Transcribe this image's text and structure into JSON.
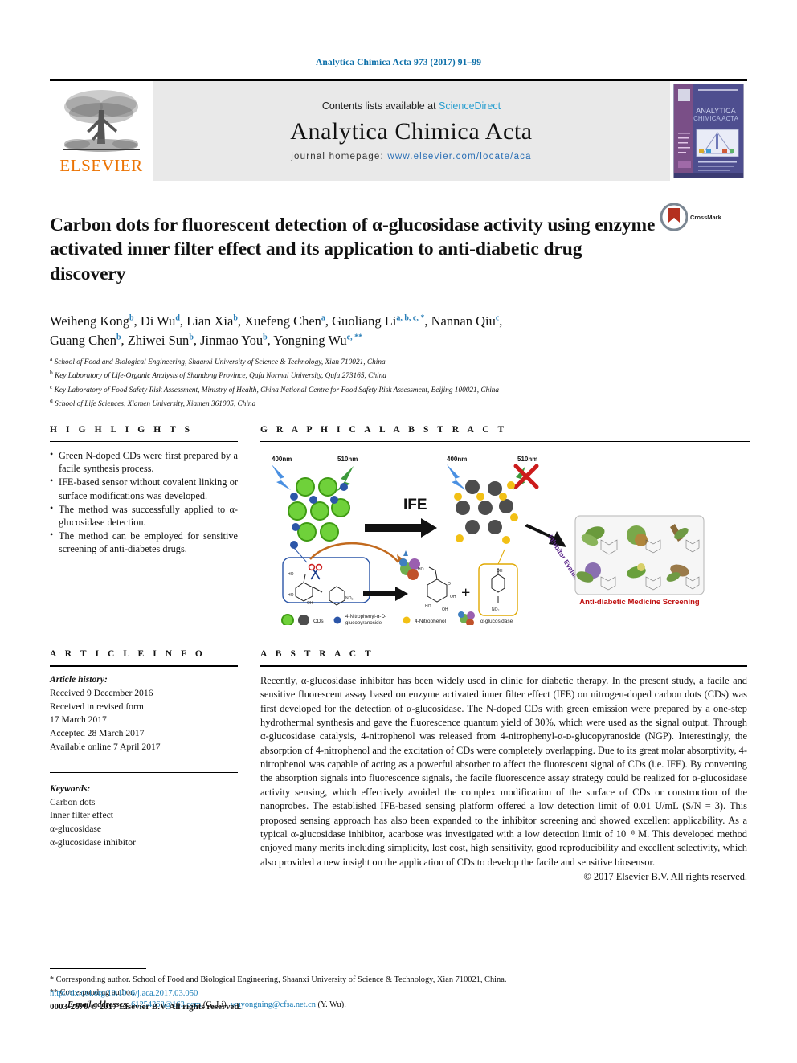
{
  "running_head": "Analytica Chimica Acta 973 (2017) 91–99",
  "masthead": {
    "publisher_logo_text": "ELSEVIER",
    "contents_prefix": "Contents lists available at ",
    "contents_link": "ScienceDirect",
    "journal_name": "Analytica Chimica Acta",
    "homepage_prefix": "journal homepage: ",
    "homepage_url": "www.elsevier.com/locate/aca",
    "cover_title_line1": "ANALYTICA",
    "cover_title_line2": "CHIMICA ACTA"
  },
  "article": {
    "title": "Carbon dots for fluorescent detection of α-glucosidase activity using enzyme activated inner filter effect and its application to anti-diabetic drug discovery",
    "crossmark_label": "CrossMark",
    "authors_line1_parts": [
      {
        "name": "Weiheng Kong",
        "sup": "b",
        "sep": ", "
      },
      {
        "name": "Di Wu",
        "sup": "d",
        "sep": ", "
      },
      {
        "name": "Lian Xia",
        "sup": "b",
        "sep": ", "
      },
      {
        "name": "Xuefeng Chen",
        "sup": "a",
        "sep": ", "
      },
      {
        "name": "Guoliang Li",
        "sup": "a, b, c, *",
        "sep": ", "
      },
      {
        "name": "Nannan Qiu",
        "sup": "c",
        "sep": ","
      }
    ],
    "authors_line2_parts": [
      {
        "name": "Guang Chen",
        "sup": "b",
        "sep": ", "
      },
      {
        "name": "Zhiwei Sun",
        "sup": "b",
        "sep": ", "
      },
      {
        "name": "Jinmao You",
        "sup": "b",
        "sep": ", "
      },
      {
        "name": "Yongning Wu",
        "sup": "c, **",
        "sep": ""
      }
    ],
    "affiliations": [
      {
        "mark": "a",
        "text": "School of Food and Biological Engineering, Shaanxi University of Science & Technology, Xian 710021, China"
      },
      {
        "mark": "b",
        "text": "Key Laboratory of Life-Organic Analysis of Shandong Province, Qufu Normal University, Qufu 273165, China"
      },
      {
        "mark": "c",
        "text": "Key Laboratory of Food Safety Risk Assessment, Ministry of Health, China National Centre for Food Safety Risk Assessment, Beijing 100021, China"
      },
      {
        "mark": "d",
        "text": "School of Life Sciences, Xiamen University, Xiamen 361005, China"
      }
    ]
  },
  "highlights": {
    "heading": "H I G H L I G H T S",
    "items": [
      "Green N-doped CDs were first prepared by a facile synthesis process.",
      "IFE-based sensor without covalent linking or surface modifications was developed.",
      "The method was successfully applied to α-glucosidase detection.",
      "The method can be employed for sensitive screening of anti-diabetes drugs."
    ]
  },
  "graphical_abstract": {
    "heading": "G R A P H I C A L  A B S T R A C T",
    "labels": {
      "excitation_left": "400nm",
      "emission_left": "510nm",
      "excitation_right": "400nm",
      "emission_right": "510nm",
      "ife": "IFE",
      "inhibitor_evaluation": "Inhibitor Evaluation",
      "screening_caption": "Anti-diabetic Medicine Screening",
      "plus": "+"
    },
    "legend": [
      "CDs",
      "4-Nitrophenyl-α-D-glucopyranoside",
      "4-Nitrophenol",
      "α-glucosidase"
    ],
    "colors": {
      "cd_green": "#5ec832",
      "cd_gray": "#4d4d4d",
      "ngp_blue": "#2c56a8",
      "np_yellow": "#f2c015",
      "arrow_black": "#111111",
      "cross_red": "#cc1b1b",
      "caption_red": "#c01010",
      "inhibitor_purple": "#5e2a8c"
    }
  },
  "article_info": {
    "heading": "A R T I C L E  I N F O",
    "history_label": "Article history:",
    "history": [
      "Received 9 December 2016",
      "Received in revised form",
      "17 March 2017",
      "Accepted 28 March 2017",
      "Available online 7 April 2017"
    ],
    "keywords_label": "Keywords:",
    "keywords": [
      "Carbon dots",
      "Inner filter effect",
      "α-glucosidase",
      "α-glucosidase inhibitor"
    ]
  },
  "abstract": {
    "heading": "A B S T R A C T",
    "body": "Recently, α-glucosidase inhibitor has been widely used in clinic for diabetic therapy. In the present study, a facile and sensitive fluorescent assay based on enzyme activated inner filter effect (IFE) on nitrogen-doped carbon dots (CDs) was first developed for the detection of α-glucosidase. The N-doped CDs with green emission were prepared by a one-step hydrothermal synthesis and gave the fluorescence quantum yield of 30%, which were used as the signal output. Through α-glucosidase catalysis, 4-nitrophenol was released from 4-nitrophenyl-α-ᴅ-glucopyranoside (NGP). Interestingly, the absorption of 4-nitrophenol and the excitation of CDs were completely overlapping. Due to its great molar absorptivity, 4-nitrophenol was capable of acting as a powerful absorber to affect the fluorescent signal of CDs (i.e. IFE). By converting the absorption signals into fluorescence signals, the facile fluorescence assay strategy could be realized for α-glucosidase activity sensing, which effectively avoided the complex modification of the surface of CDs or construction of the nanoprobes. The established IFE-based sensing platform offered a low detection limit of 0.01 U/mL (S/N = 3). This proposed sensing approach has also been expanded to the inhibitor screening and showed excellent applicability. As a typical α-glucosidase inhibitor, acarbose was investigated with a low detection limit of 10⁻⁸ M. This developed method enjoyed many merits including simplicity, lost cost, high sensitivity, good reproducibility and excellent selectivity, which also provided a new insight on the application of CDs to develop the facile and sensitive biosensor.",
    "copyright": "© 2017 Elsevier B.V. All rights reserved."
  },
  "footnotes": {
    "corresponding_1_mark": "*",
    "corresponding_1": "Corresponding author. School of Food and Biological Engineering, Shaanxi University of Science & Technology, Xian 710021, China.",
    "corresponding_2_mark": "**",
    "corresponding_2": "Corresponding author.",
    "email_label": "E-mail addresses:",
    "email_1": "61254368@163.com",
    "email_1_owner": " (G. Li), ",
    "email_2": "wuyongning@cfsa.net.cn",
    "email_2_owner": " (Y. Wu)."
  },
  "footer": {
    "doi": "http://dx.doi.org/10.1016/j.aca.2017.03.050",
    "issn_line": "0003-2670/© 2017 Elsevier B.V. All rights reserved."
  }
}
